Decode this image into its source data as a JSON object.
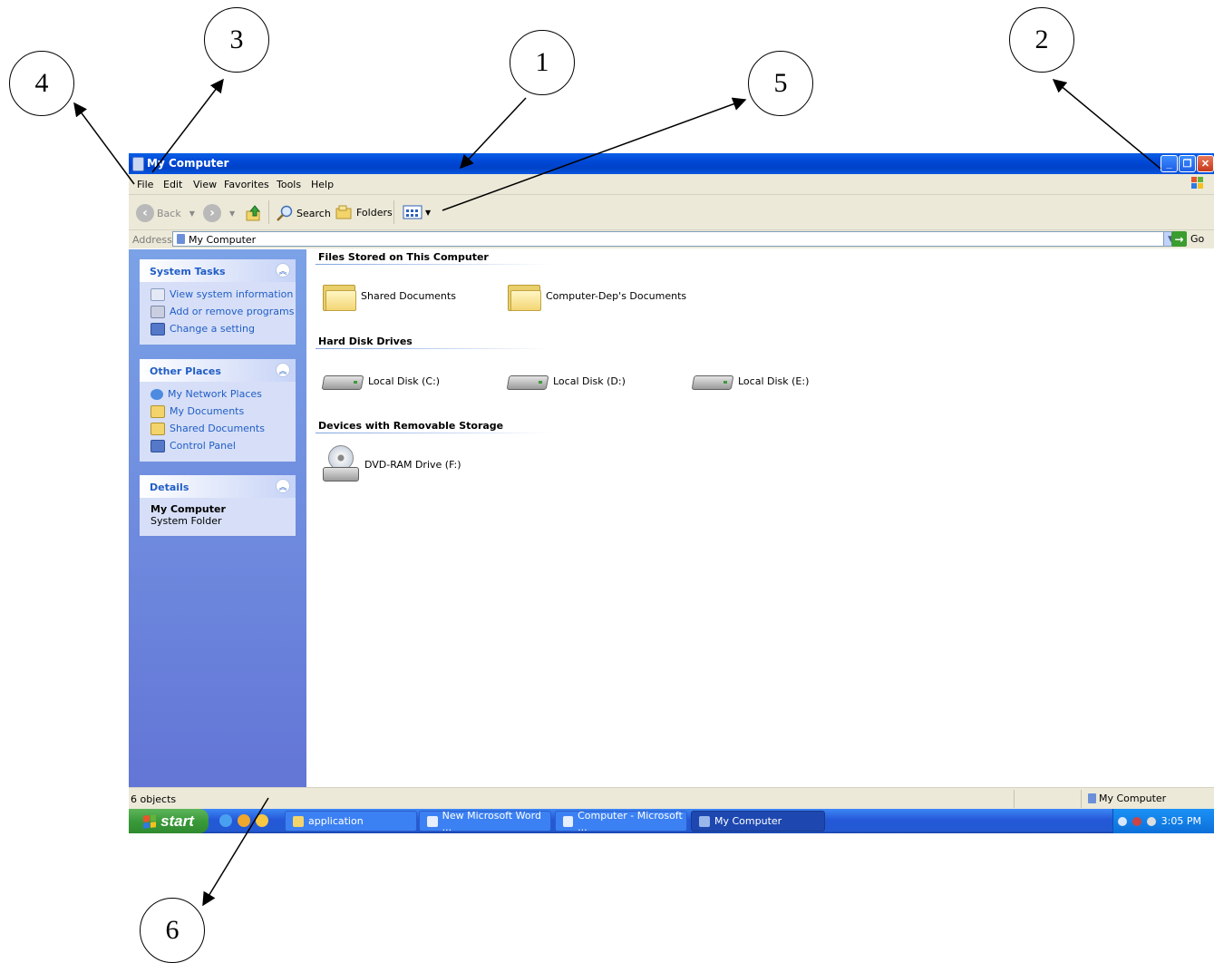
{
  "callouts": [
    "1",
    "2",
    "3",
    "4",
    "5",
    "6"
  ],
  "window": {
    "title": "My Computer",
    "menu": [
      "File",
      "Edit",
      "View",
      "Favorites",
      "Tools",
      "Help"
    ],
    "toolbar": {
      "back": "Back",
      "search": "Search",
      "folders": "Folders"
    },
    "address": {
      "label": "Address",
      "value": "My Computer",
      "go": "Go"
    }
  },
  "sidebar": {
    "system_tasks": {
      "title": "System Tasks",
      "items": [
        "View system information",
        "Add or remove programs",
        "Change a setting"
      ]
    },
    "other_places": {
      "title": "Other Places",
      "items": [
        "My Network Places",
        "My Documents",
        "Shared Documents",
        "Control Panel"
      ]
    },
    "details": {
      "title": "Details",
      "name": "My Computer",
      "type": "System Folder"
    }
  },
  "content": {
    "files_group": "Files Stored on This Computer",
    "files": [
      "Shared Documents",
      "Computer-Dep's Documents"
    ],
    "disks_group": "Hard Disk Drives",
    "disks": [
      "Local Disk (C:)",
      "Local Disk (D:)",
      "Local Disk (E:)"
    ],
    "removable_group": "Devices with Removable Storage",
    "removable": [
      "DVD-RAM Drive (F:)"
    ]
  },
  "status": {
    "left": "6 objects",
    "right": "My Computer"
  },
  "taskbar": {
    "start": "start",
    "buttons": [
      "application",
      "New Microsoft Word ...",
      "Computer - Microsoft ...",
      "My Computer"
    ],
    "clock": "3:05 PM"
  }
}
